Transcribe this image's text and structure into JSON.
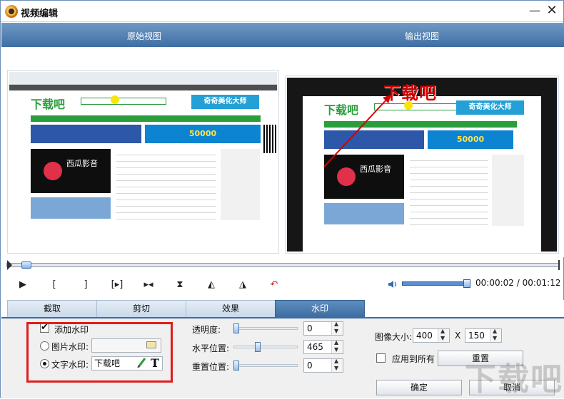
{
  "window": {
    "title": "视频编辑",
    "minimize_label": "—",
    "close_label": "✕"
  },
  "view_header": {
    "original": "原始视图",
    "output": "输出视图"
  },
  "preview": {
    "left_banner": "奇奇美化大师",
    "left_band_text": "50000",
    "left_player_text": "西瓜影音",
    "left_logo": "下载吧",
    "right_banner": "奇奇美化大师",
    "right_band_text": "50000",
    "right_player_text": "西瓜影音",
    "right_logo": "下载吧",
    "watermark_text": "下载吧"
  },
  "controls": {
    "play_icon": "play-icon",
    "time_display": "00:00:02 / 00:01:12"
  },
  "tabs": [
    {
      "label": "截取"
    },
    {
      "label": "剪切"
    },
    {
      "label": "效果"
    },
    {
      "label": "水印"
    }
  ],
  "watermark_panel": {
    "add_watermark_label": "添加水印",
    "image_watermark_label": "图片水印:",
    "text_watermark_label": "文字水印:",
    "text_watermark_value": "下载吧",
    "transparency_label": "透明度:",
    "transparency_value": "0",
    "h_position_label": "水平位置:",
    "h_position_value": "465",
    "v_position_label": "重置位置:",
    "v_position_value": "0",
    "image_size_label": "图像大小:",
    "image_width": "400",
    "image_x": "X",
    "image_height": "150",
    "apply_all_label": "应用到所有",
    "reset_label": "重置",
    "ok_label": "确定",
    "cancel_label": "取消"
  },
  "corner_watermark": "下载吧"
}
